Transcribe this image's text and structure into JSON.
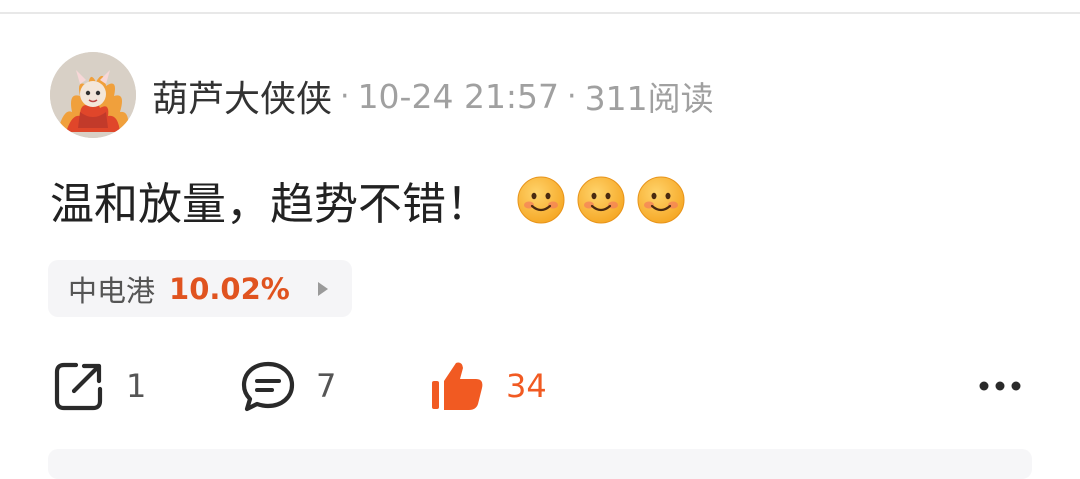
{
  "post": {
    "author": "葫芦大侠侠",
    "separator": "·",
    "time": "10-24 21:57",
    "reads": "311阅读",
    "text": "温和放量，趋势不错！",
    "emojis": [
      "smiling-emoji",
      "smiling-emoji",
      "smiling-emoji"
    ]
  },
  "stock_tag": {
    "name": "中电港",
    "change": "10.02%"
  },
  "actions": {
    "share_count": "1",
    "comment_count": "7",
    "like_count": "34",
    "like_active": true
  },
  "icons": {
    "share": "share-icon",
    "comment": "comment-icon",
    "like": "thumbs-up-icon",
    "more": "more-dots-icon"
  },
  "colors": {
    "accent": "#f15a22",
    "stock_up": "#e0531f",
    "muted": "#a0a0a0"
  }
}
